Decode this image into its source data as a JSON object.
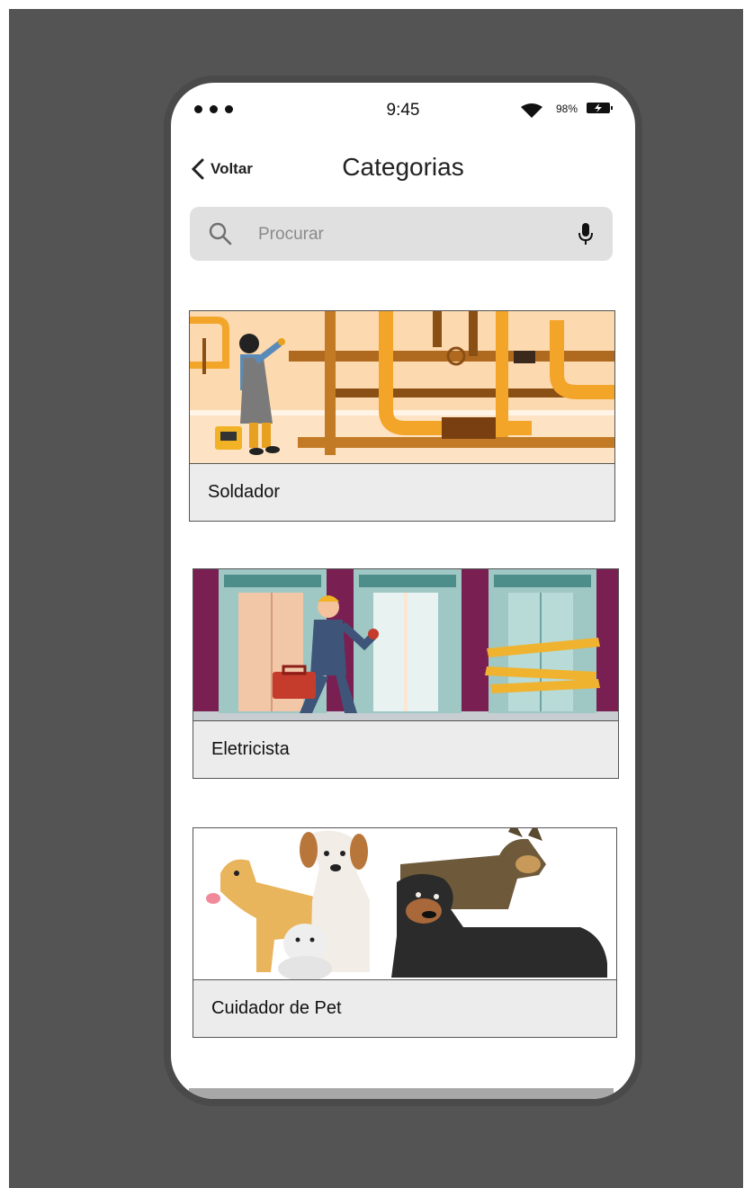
{
  "status_bar": {
    "time": "9:45",
    "battery_percent": "98%"
  },
  "nav": {
    "back_label": "Voltar",
    "title": "Categorias"
  },
  "search": {
    "placeholder": "Procurar",
    "value": ""
  },
  "categories": [
    {
      "label": "Soldador",
      "illustration": "welder-pipes"
    },
    {
      "label": "Eletricista",
      "illustration": "technician-elevators"
    },
    {
      "label": "Cuidador de Pet",
      "illustration": "group-of-dogs"
    }
  ],
  "icons": {
    "signal": "signal-dots-icon",
    "wifi": "wifi-icon",
    "battery": "battery-charging-icon",
    "back": "chevron-left-icon",
    "search": "search-icon",
    "mic": "microphone-icon"
  },
  "colors": {
    "background": "#545454",
    "search_bg": "#e0e0e0",
    "card_label_bg": "#ececec",
    "pipe_orange": "#f3a52a",
    "elevator_wall": "#7a1f52"
  }
}
